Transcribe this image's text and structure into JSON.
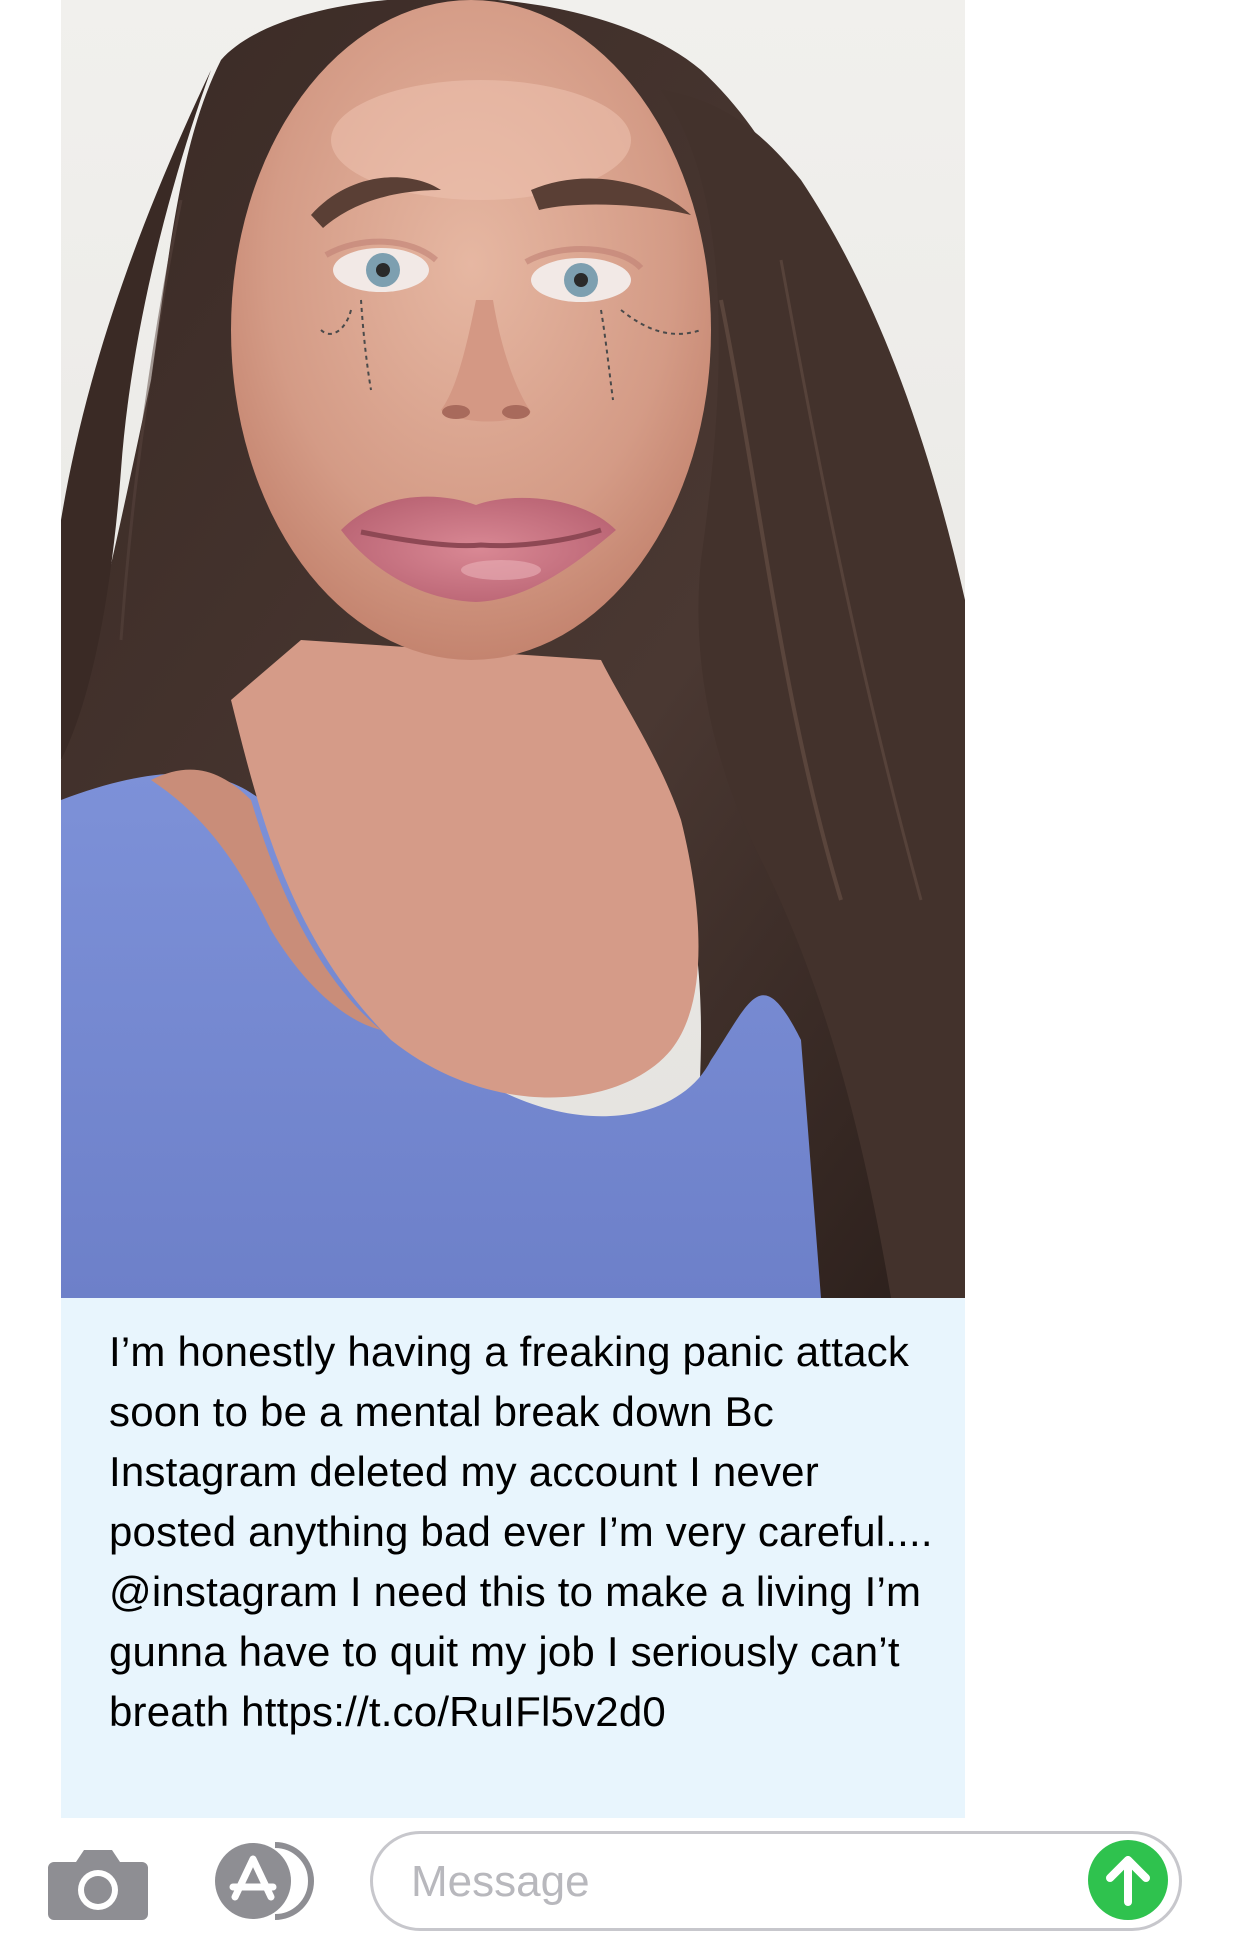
{
  "message": {
    "link_preview": {
      "image": {
        "subject": "photo of a crying woman with long dark hair in a blue top",
        "colors": {
          "background": "#eeede9",
          "hair": "#3b2c28",
          "skin": "#d9a58f",
          "shirt": "#7c8fd6",
          "card": "#e8f5fd"
        }
      },
      "caption": "I’m honestly having a freaking panic attack soon to be a mental break down Bc Instagram deleted my account I never posted anything bad ever I’m very careful.... @instagram I need this to make a living I’m gunna have to quit my job I seriously can’t breath https://t.co/RuIFl5v2d0"
    }
  },
  "input_bar": {
    "camera_icon": "camera-icon",
    "apps_icon": "app-store-icon",
    "message_placeholder": "Message",
    "send_icon": "arrow-up-icon",
    "colors": {
      "send": "#2fc24e",
      "icon_gray": "#8e8e93",
      "field_border": "#c7c7cc"
    }
  }
}
